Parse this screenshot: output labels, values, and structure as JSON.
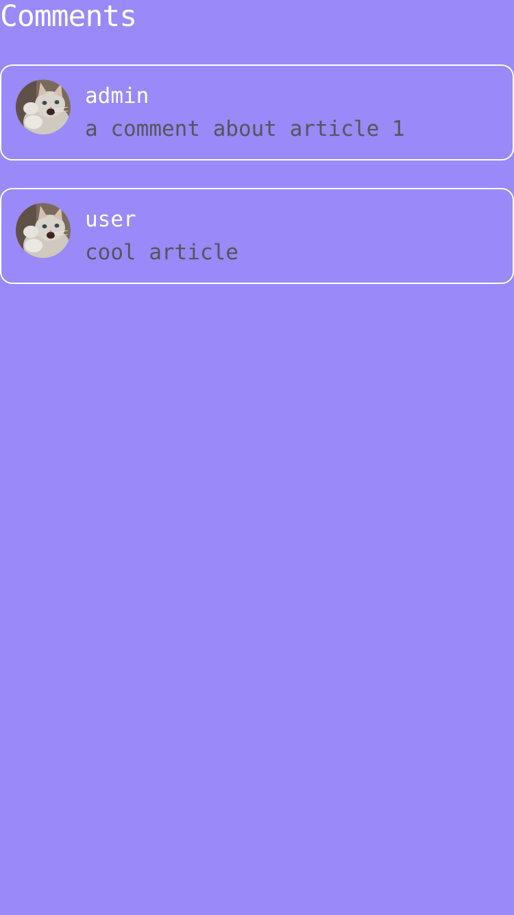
{
  "page": {
    "title": "Comments",
    "background_color": "#9a89f8"
  },
  "comments": [
    {
      "author": "admin",
      "text": "a comment about article 1",
      "avatar_icon": "cat-avatar"
    },
    {
      "author": "user",
      "text": "cool article",
      "avatar_icon": "cat-avatar"
    }
  ]
}
